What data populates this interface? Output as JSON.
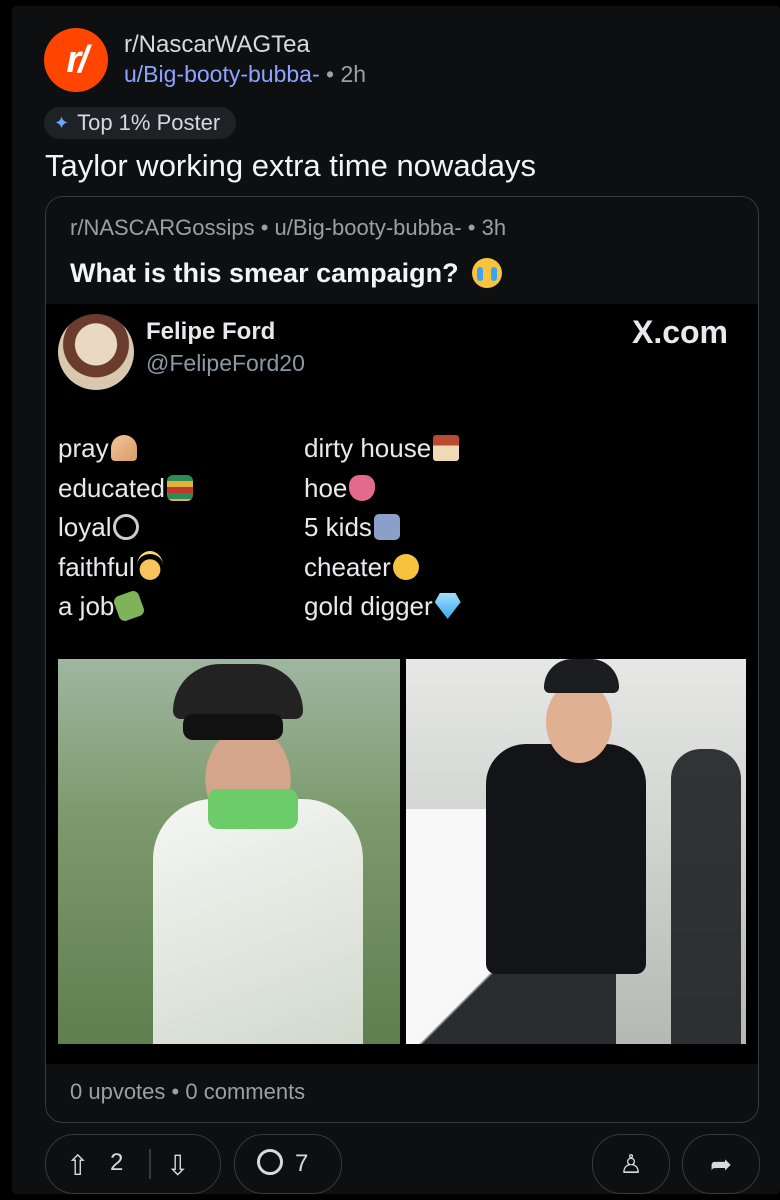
{
  "post": {
    "subreddit": "r/NascarWAGTea",
    "subreddit_icon_text": "r/",
    "author": "u/Big-booty-bubba-",
    "age": "2h",
    "flair": "Top 1% Poster",
    "title": "Taylor working extra time nowadays"
  },
  "crosspost": {
    "subreddit": "r/NASCARGossips",
    "author": "u/Big-booty-bubba-",
    "age": "3h",
    "title": "What is this smear campaign?",
    "upvotes": "0 upvotes",
    "comments": "0 comments"
  },
  "tweet": {
    "name": "Felipe Ford",
    "handle": "@FelipeFord20",
    "source": "X.com",
    "left_list": [
      "pray",
      "educated",
      "loyal",
      "faithful",
      "a job"
    ],
    "right_list": [
      "dirty house",
      "hoe",
      "5 kids",
      "cheater",
      "gold digger"
    ]
  },
  "actions": {
    "upvote_count": "2",
    "comment_count": "7"
  },
  "colors": {
    "subreddit_icon": "#ff4500",
    "user_link": "#8ea3ff",
    "background": "#0d0f10"
  }
}
